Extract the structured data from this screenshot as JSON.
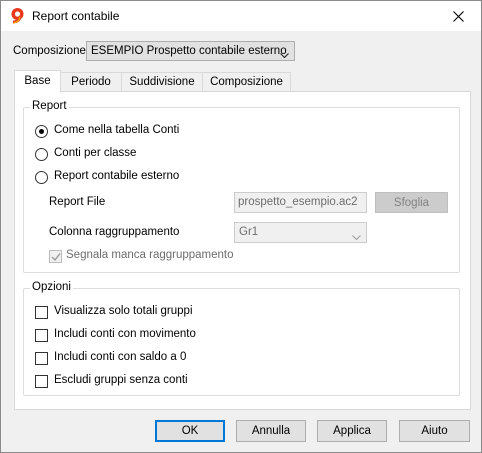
{
  "window": {
    "title": "Report contabile",
    "app_icon": "banana-nine-icon",
    "close_icon": "close-icon"
  },
  "composizione": {
    "label": "Composizione:",
    "selected": "ESEMPIO Prospetto contabile esterno",
    "icon": "chevron-down-icon"
  },
  "tabs": [
    {
      "label": "Base",
      "selected": true
    },
    {
      "label": "Periodo",
      "selected": false
    },
    {
      "label": "Suddivisione",
      "selected": false
    },
    {
      "label": "Composizione",
      "selected": false
    }
  ],
  "report_group": {
    "title": "Report",
    "options": [
      {
        "label": "Come nella tabella Conti",
        "checked": true
      },
      {
        "label": "Conti per classe",
        "checked": false
      },
      {
        "label": "Report contabile esterno",
        "checked": false
      }
    ],
    "report_file": {
      "label": "Report File",
      "value": "prospetto_esempio.ac2",
      "browse_label": "Sfoglia"
    },
    "colonna": {
      "label": "Colonna raggruppamento",
      "selected": "Gr1"
    },
    "segnala": {
      "label": "Segnala manca raggruppamento",
      "checked": true,
      "disabled": true
    }
  },
  "opzioni_group": {
    "title": "Opzioni",
    "checkboxes": [
      {
        "label": "Visualizza solo totali gruppi",
        "checked": false
      },
      {
        "label": "Includi conti con movimento",
        "checked": false
      },
      {
        "label": "Includi conti con saldo a 0",
        "checked": false
      },
      {
        "label": "Escludi gruppi senza conti",
        "checked": false
      }
    ]
  },
  "buttons": {
    "ok": "OK",
    "cancel": "Annulla",
    "apply": "Applica",
    "help": "Aiuto"
  }
}
